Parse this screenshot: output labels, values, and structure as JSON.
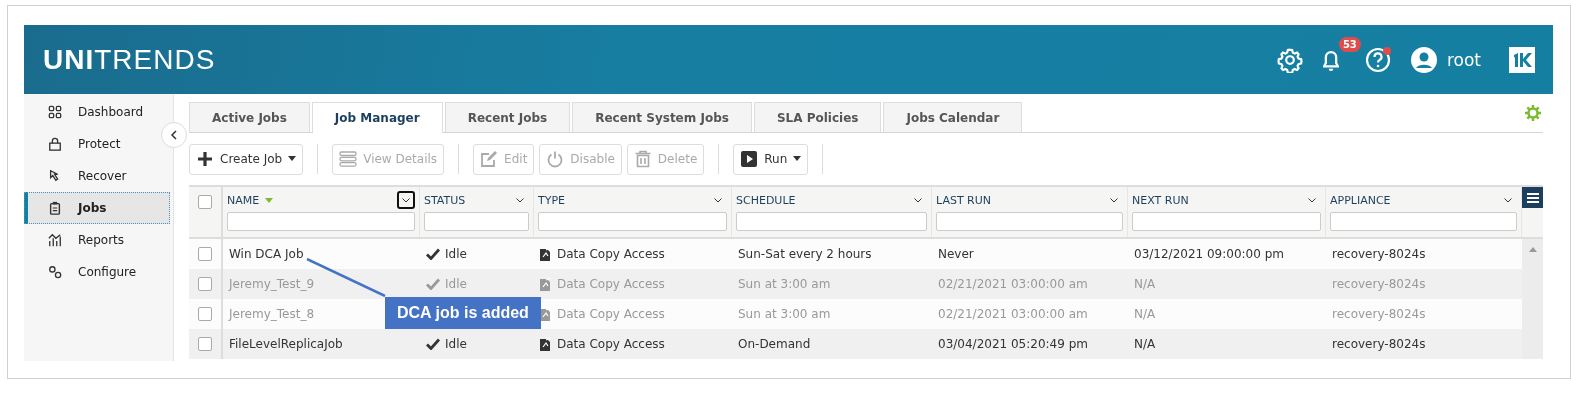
{
  "header": {
    "logo": "**UNI**TRENDS",
    "notifications": "53",
    "user": "root"
  },
  "sidebar": {
    "items": [
      {
        "label": "Dashboard",
        "selected": false
      },
      {
        "label": "Protect",
        "selected": false
      },
      {
        "label": "Recover",
        "selected": false
      },
      {
        "label": "Jobs",
        "selected": true
      },
      {
        "label": "Reports",
        "selected": false
      },
      {
        "label": "Configure",
        "selected": false
      }
    ]
  },
  "tabs": [
    {
      "label": "Active Jobs",
      "selected": false
    },
    {
      "label": "Job Manager",
      "selected": true
    },
    {
      "label": "Recent Jobs",
      "selected": false
    },
    {
      "label": "Recent System Jobs",
      "selected": false
    },
    {
      "label": "SLA Policies",
      "selected": false
    },
    {
      "label": "Jobs Calendar",
      "selected": false
    }
  ],
  "toolbar": [
    {
      "kind": "button",
      "label": "Create Job",
      "menu": true,
      "disabled": false
    },
    {
      "kind": "separator"
    },
    {
      "kind": "button",
      "label": "View Details",
      "menu": false,
      "disabled": true
    },
    {
      "kind": "separator"
    },
    {
      "kind": "button",
      "label": "Edit",
      "menu": false,
      "disabled": true
    },
    {
      "kind": "button",
      "label": "Disable",
      "menu": false,
      "disabled": true
    },
    {
      "kind": "button",
      "label": "Delete",
      "menu": false,
      "disabled": true
    },
    {
      "kind": "separator"
    },
    {
      "kind": "button",
      "label": "Run",
      "menu": true,
      "disabled": false
    },
    {
      "kind": "separator"
    }
  ],
  "table": {
    "all_checked": false,
    "columns": [
      {
        "label": "NAME",
        "sorted": true,
        "focused": true
      },
      {
        "label": "STATUS",
        "sorted": false,
        "focused": false
      },
      {
        "label": "TYPE",
        "sorted": false,
        "focused": false
      },
      {
        "label": "SCHEDULE",
        "sorted": false,
        "focused": false
      },
      {
        "label": "LAST RUN",
        "sorted": false,
        "focused": false
      },
      {
        "label": "NEXT RUN",
        "sorted": false,
        "focused": false
      },
      {
        "label": "APPLIANCE",
        "sorted": false,
        "focused": false
      }
    ],
    "rows": [
      {
        "name": "Win DCA Job",
        "status": "Idle",
        "type": "Data Copy Access",
        "schedule": "Sun-Sat every 2 hours",
        "last_run": "Never",
        "next_run": "03/12/2021 09:00:00 pm",
        "appliance": "recovery-8024s",
        "checked": false,
        "disabled": false
      },
      {
        "name": "Jeremy_Test_9",
        "status": "Idle",
        "type": "Data Copy Access",
        "schedule": "Sun at 3:00 am",
        "last_run": "02/21/2021 03:00:00 am",
        "next_run": "N/A",
        "appliance": "recovery-8024s",
        "checked": false,
        "disabled": true
      },
      {
        "name": "Jeremy_Test_8",
        "type": "Data Copy Access",
        "schedule": "Sun at 3:00 am",
        "last_run": "02/21/2021 03:00:00 am",
        "next_run": "N/A",
        "appliance": "recovery-8024s",
        "checked": false,
        "disabled": true
      },
      {
        "name": "FileLevelReplicaJob",
        "status": "Idle",
        "type": "Data Copy Access",
        "schedule": "On-Demand",
        "last_run": "03/04/2021 05:20:49 pm",
        "next_run": "N/A",
        "appliance": "recovery-8024s",
        "checked": false,
        "disabled": false
      }
    ]
  },
  "callout": {
    "text": "DCA job is added"
  }
}
